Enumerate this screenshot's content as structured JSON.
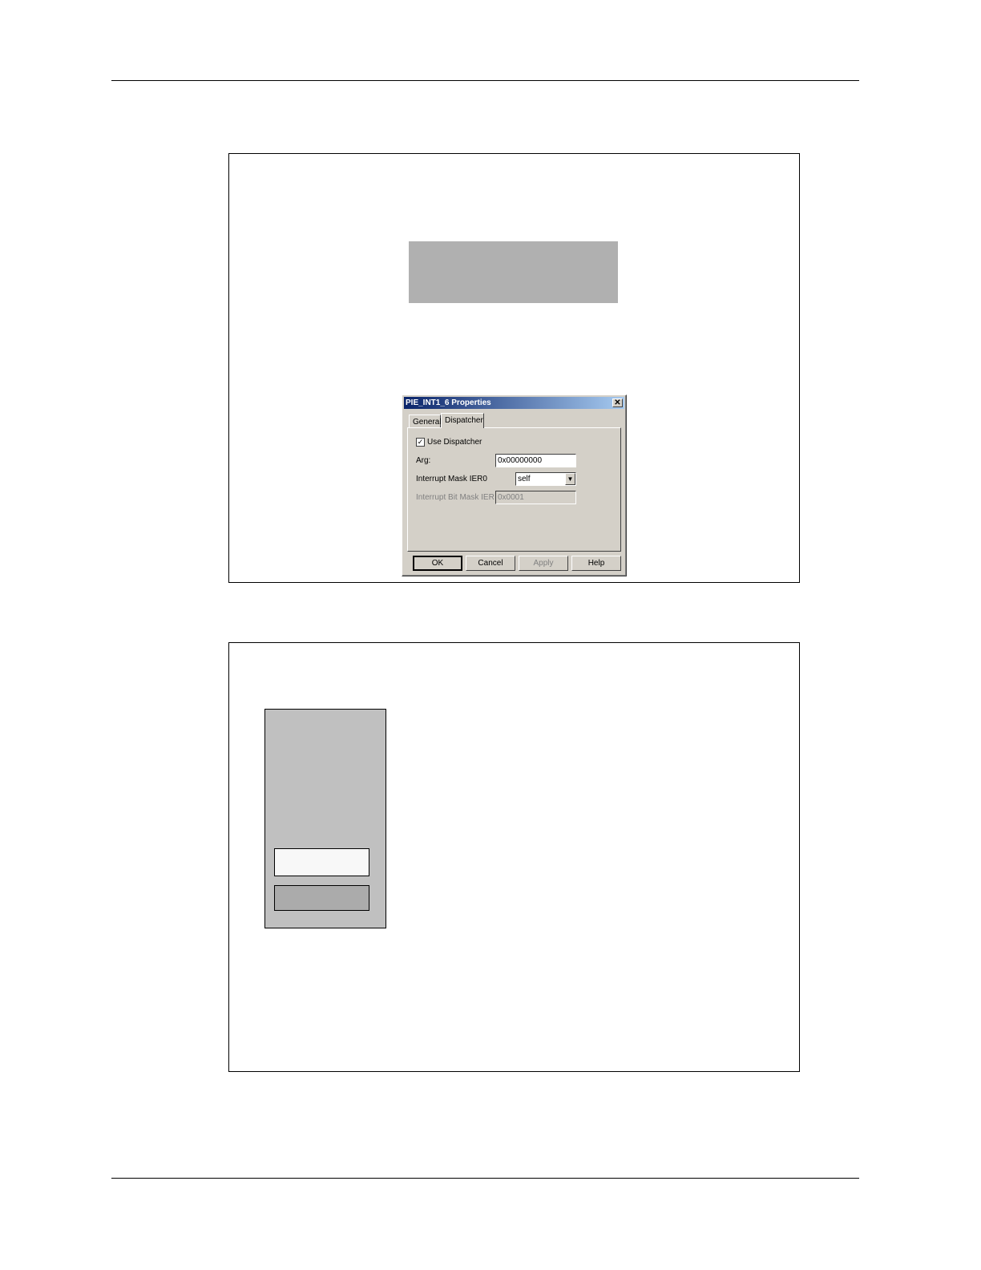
{
  "dialog": {
    "title": "PIE_INT1_6 Properties",
    "close_glyph": "✕",
    "tabs": [
      {
        "label": "General"
      },
      {
        "label": "Dispatcher"
      }
    ],
    "use_dispatcher_label": "Use Dispatcher",
    "use_dispatcher_checked": true,
    "check_glyph": "✓",
    "arg_label": "Arg:",
    "arg_value": "0x00000000",
    "mask_label": "Interrupt Mask IER0",
    "mask_value": "self",
    "dropdown_glyph": "▼",
    "bit_mask_label": "Interrupt Bit Mask IER",
    "bit_mask_value": "0x0001",
    "buttons": {
      "ok": "OK",
      "cancel": "Cancel",
      "apply": "Apply",
      "help": "Help"
    }
  }
}
